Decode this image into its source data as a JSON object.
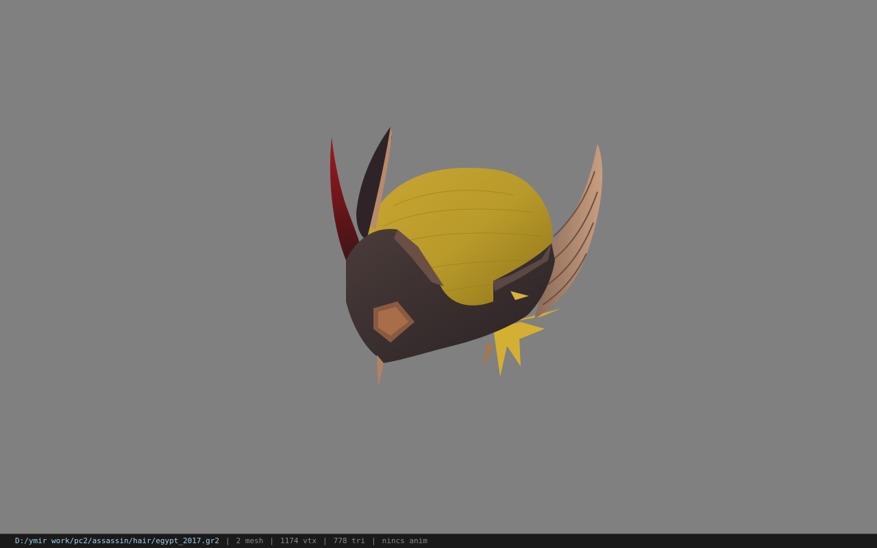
{
  "viewer": {
    "background_color": "#808080",
    "model_icon": "helmet-hair-model"
  },
  "status": {
    "file_path": "D:/ymir work/pc2/assassin/hair/egypt_2017.gr2",
    "separator": "|",
    "mesh": "2 mesh",
    "vertices": "1174 vtx",
    "triangles": "778 tri",
    "anim": "nincs anim",
    "path_color": "#9fd3ee",
    "text_color": "#8a8a8a"
  }
}
